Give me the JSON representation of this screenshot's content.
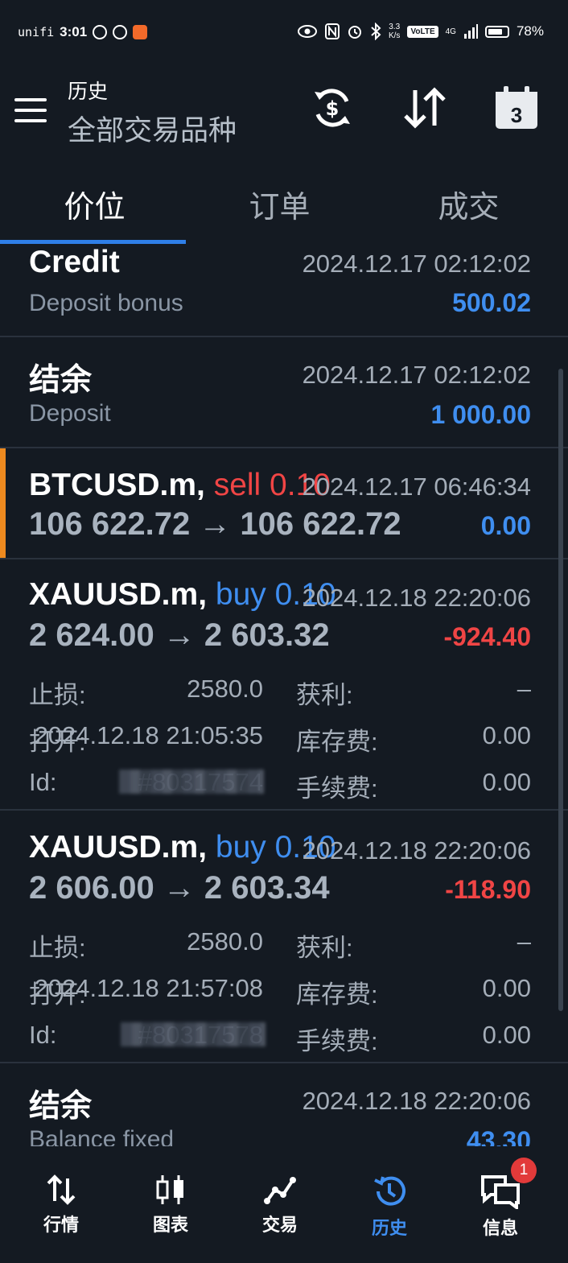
{
  "status_bar": {
    "carrier": "unifi",
    "time": "3:01",
    "net_speed_value": "3.3",
    "net_speed_unit": "K/s",
    "volte": "VoLTE",
    "signal": "4G",
    "battery": "78%",
    "battery_level": 0.78
  },
  "header": {
    "title": "历史",
    "subtitle": "全部交易品种",
    "calendar_day": "3"
  },
  "tabs": [
    {
      "label": "价位"
    },
    {
      "label": "订单"
    },
    {
      "label": "成交"
    }
  ],
  "colors": {
    "accent": "#2f7fe8",
    "profit": "#3f8ef0",
    "loss": "#f04545",
    "marker": "#ee8a1f",
    "background": "#141a22"
  },
  "history": [
    {
      "type": "credit",
      "title": "Credit",
      "comment": "Deposit bonus",
      "time": "2024.12.17 02:12:02",
      "amount": "500.02"
    },
    {
      "type": "balance",
      "title": "结余",
      "comment": "Deposit",
      "time": "2024.12.17 02:12:02",
      "amount": "1 000.00"
    },
    {
      "type": "deal",
      "symbol": "BTCUSD.m,",
      "direction": "sell 0.10",
      "prices": "106 622.72 → 106 622.72",
      "time": "2024.12.17 06:46:34",
      "profit": "0.00"
    },
    {
      "type": "deal",
      "symbol": "XAUUSD.m,",
      "direction": "buy 0.10",
      "prices": "2 624.00 → 2 603.32",
      "time": "2024.12.18 22:20:06",
      "profit": "-924.40",
      "details": {
        "sl_label": "止损:",
        "sl": "2580.0",
        "tp_label": "获利:",
        "tp": "–",
        "open_label": "打开:",
        "open": "2024.12.18 21:05:35",
        "swap_label": "库存费:",
        "swap": "0.00",
        "id_label": "Id:",
        "id": "#80317574",
        "fee_label": "手续费:",
        "fee": "0.00"
      }
    },
    {
      "type": "deal",
      "symbol": "XAUUSD.m,",
      "direction": "buy 0.10",
      "prices": "2 606.00 → 2 603.34",
      "time": "2024.12.18 22:20:06",
      "profit": "-118.90",
      "details": {
        "sl_label": "止损:",
        "sl": "2580.0",
        "tp_label": "获利:",
        "tp": "–",
        "open_label": "打开:",
        "open": "2024.12.18 21:57:08",
        "swap_label": "库存费:",
        "swap": "0.00",
        "id_label": "Id:",
        "id": "#80317578",
        "fee_label": "手续费:",
        "fee": "0.00"
      }
    },
    {
      "type": "balance",
      "title": "结余",
      "comment": "Balance fixed",
      "time": "2024.12.18 22:20:06",
      "amount": "43.30"
    }
  ],
  "bottom_nav": [
    {
      "label": "行情",
      "icon": "quotes-icon"
    },
    {
      "label": "图表",
      "icon": "chart-icon"
    },
    {
      "label": "交易",
      "icon": "trade-icon"
    },
    {
      "label": "历史",
      "icon": "history-icon",
      "active": true
    },
    {
      "label": "信息",
      "icon": "messages-icon",
      "badge": "1"
    }
  ]
}
